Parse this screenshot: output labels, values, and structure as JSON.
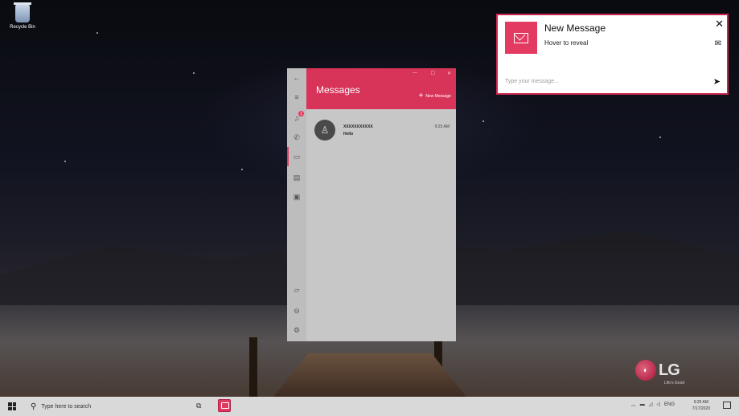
{
  "desktop": {
    "recycle_bin_label": "Recycle Bin"
  },
  "app": {
    "title": "Messages",
    "new_message_label": "New Message",
    "conversations": [
      {
        "name": "XXXXXXXXXXX",
        "preview": "Hello",
        "time": "9:25 AM"
      }
    ],
    "notification_badge": "1"
  },
  "toast": {
    "title": "New Message",
    "subtitle": "Hover to reveal",
    "input_placeholder": "Type your message..."
  },
  "logo": {
    "brand": "LG",
    "tagline": "Life's Good"
  },
  "taskbar": {
    "search_placeholder": "Type here to search",
    "language": "ENG",
    "time": "9:25 AM",
    "date": "7/17/2020"
  },
  "colors": {
    "accent": "#d8345a",
    "toast_border": "#c8284f"
  }
}
